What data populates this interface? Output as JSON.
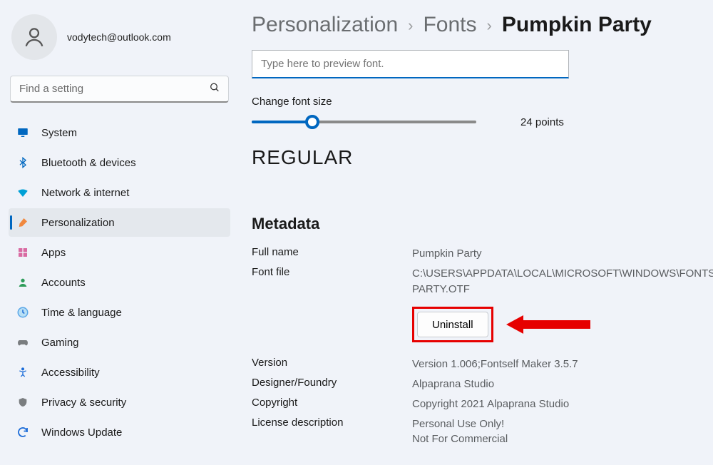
{
  "user": {
    "email": "vodytech@outlook.com"
  },
  "search": {
    "placeholder": "Find a setting"
  },
  "sidebar": {
    "items": [
      {
        "label": "System"
      },
      {
        "label": "Bluetooth & devices"
      },
      {
        "label": "Network & internet"
      },
      {
        "label": "Personalization"
      },
      {
        "label": "Apps"
      },
      {
        "label": "Accounts"
      },
      {
        "label": "Time & language"
      },
      {
        "label": "Gaming"
      },
      {
        "label": "Accessibility"
      },
      {
        "label": "Privacy & security"
      },
      {
        "label": "Windows Update"
      }
    ]
  },
  "breadcrumb": {
    "lvl1": "Personalization",
    "lvl2": "Fonts",
    "current": "Pumpkin Party"
  },
  "preview": {
    "placeholder": "Type here to preview font.",
    "size_label": "Change font size",
    "size_value": "24 points",
    "style_name": "REGULAR"
  },
  "metadata": {
    "title": "Metadata",
    "rows": {
      "fullname_k": "Full name",
      "fullname_v": "Pumpkin Party",
      "fontfile_k": "Font file",
      "fontfile_v": "C:\\USERS\\APPDATA\\LOCAL\\MICROSOFT\\WINDOWS\\FONTS\\PUMPKIN PARTY.OTF",
      "uninstall": "Uninstall",
      "version_k": "Version",
      "version_v": "Version 1.006;Fontself Maker 3.5.7",
      "designer_k": "Designer/Foundry",
      "designer_v": "Alpaprana Studio",
      "copyright_k": "Copyright",
      "copyright_v": "Copyright 2021 Alpaprana Studio",
      "license_k": "License description",
      "license_v": "Personal Use Only!\nNot For Commercial"
    }
  }
}
